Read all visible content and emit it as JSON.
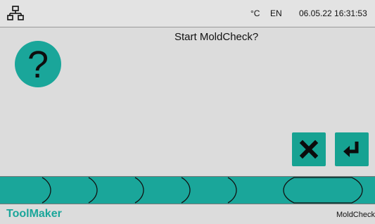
{
  "header": {
    "unit": "°C",
    "language": "EN",
    "datetime": "06.05.22 16:31:53",
    "network_icon": "network-icon"
  },
  "dialog": {
    "prompt": "Start MoldCheck?",
    "question_mark": "?",
    "icon": "question-icon",
    "cancel_icon": "close-icon",
    "confirm_icon": "enter-icon"
  },
  "tab_bar": {
    "tab_count": 8
  },
  "footer": {
    "brand": "ToolMaker",
    "screen_name": "MoldCheck"
  },
  "colors": {
    "accent": "#1aa69a",
    "background": "#dcdcdc",
    "text": "#111111"
  }
}
